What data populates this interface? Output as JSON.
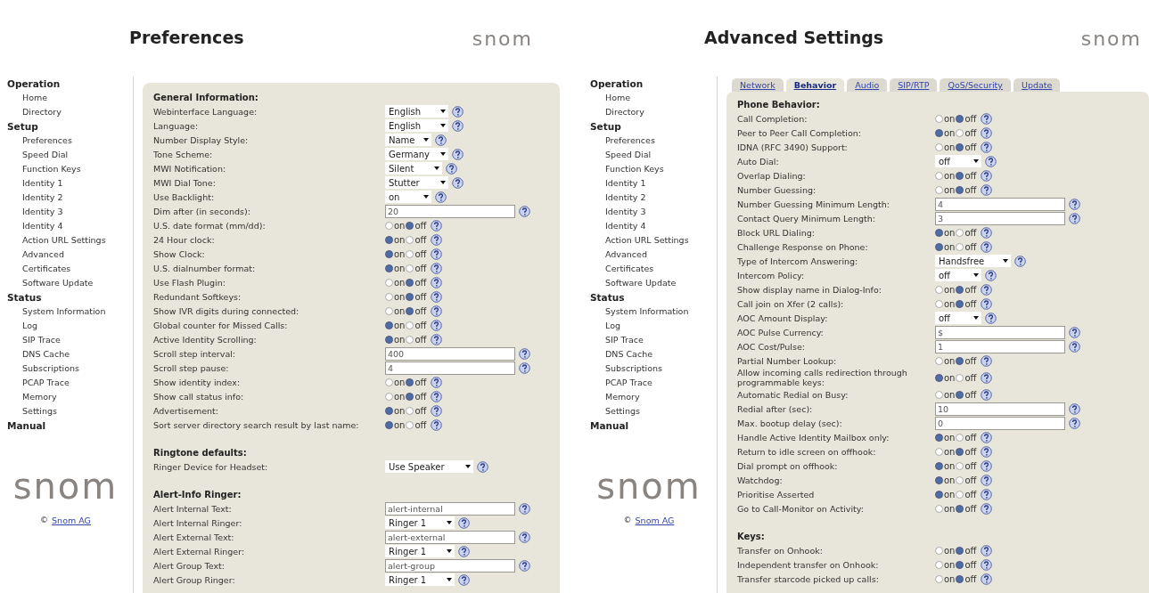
{
  "panels": [
    {
      "title": "Preferences",
      "header_logo": "snom",
      "sidebar": {
        "sections": [
          {
            "heading": "Operation",
            "items": [
              "Home",
              "Directory"
            ]
          },
          {
            "heading": "Setup",
            "items": [
              "Preferences",
              "Speed Dial",
              "Function Keys",
              "Identity 1",
              "Identity 2",
              "Identity 3",
              "Identity 4",
              "Action URL Settings",
              "Advanced",
              "Certificates",
              "Software Update"
            ]
          },
          {
            "heading": "Status",
            "items": [
              "System Information",
              "Log",
              "SIP Trace",
              "DNS Cache",
              "Subscriptions",
              "PCAP Trace",
              "Memory",
              "Settings"
            ]
          },
          {
            "heading": "Manual"
          }
        ],
        "logo": "snom",
        "copyright": {
          "symbol": "©",
          "link": "Snom AG"
        }
      },
      "form": {
        "sections": [
          {
            "heading": "General Information:",
            "rows": [
              {
                "kind": "select",
                "label": "Webinterface Language:",
                "value": "English"
              },
              {
                "kind": "select",
                "label": "Language:",
                "value": "English"
              },
              {
                "kind": "select",
                "label": "Number Display Style:",
                "value": "Name"
              },
              {
                "kind": "select",
                "label": "Tone Scheme:",
                "value": "Germany"
              },
              {
                "kind": "select",
                "label": "MWI Notification:",
                "value": "Silent"
              },
              {
                "kind": "select",
                "label": "MWI Dial Tone:",
                "value": "Stutter"
              },
              {
                "kind": "select",
                "label": "Use Backlight:",
                "value": "on"
              },
              {
                "kind": "text",
                "label": "Dim after (in seconds):",
                "value": "20"
              },
              {
                "kind": "radio",
                "label": "U.S. date format (mm/dd):",
                "options": [
                  {
                    "label": "on",
                    "selected": false
                  },
                  {
                    "label": "off",
                    "selected": true
                  }
                ]
              },
              {
                "kind": "radio",
                "label": "24 Hour clock:",
                "options": [
                  {
                    "label": "on",
                    "selected": true
                  },
                  {
                    "label": "off",
                    "selected": false
                  }
                ]
              },
              {
                "kind": "radio",
                "label": "Show Clock:",
                "options": [
                  {
                    "label": "on",
                    "selected": true
                  },
                  {
                    "label": "off",
                    "selected": false
                  }
                ]
              },
              {
                "kind": "radio",
                "label": "U.S. dialnumber format:",
                "options": [
                  {
                    "label": "on",
                    "selected": true
                  },
                  {
                    "label": "off",
                    "selected": false
                  }
                ]
              },
              {
                "kind": "radio",
                "label": "Use Flash Plugin:",
                "options": [
                  {
                    "label": "on",
                    "selected": false
                  },
                  {
                    "label": "off",
                    "selected": true
                  }
                ]
              },
              {
                "kind": "radio",
                "label": "Redundant Softkeys:",
                "options": [
                  {
                    "label": "on",
                    "selected": false
                  },
                  {
                    "label": "off",
                    "selected": true
                  }
                ]
              },
              {
                "kind": "radio",
                "label": "Show IVR digits during connected:",
                "options": [
                  {
                    "label": "on",
                    "selected": false
                  },
                  {
                    "label": "off",
                    "selected": true
                  }
                ]
              },
              {
                "kind": "radio",
                "label": "Global counter for Missed Calls:",
                "options": [
                  {
                    "label": "on",
                    "selected": true
                  },
                  {
                    "label": "off",
                    "selected": false
                  }
                ]
              },
              {
                "kind": "radio",
                "label": "Active Identity Scrolling:",
                "options": [
                  {
                    "label": "on",
                    "selected": true
                  },
                  {
                    "label": "off",
                    "selected": false
                  }
                ]
              },
              {
                "kind": "text",
                "label": "Scroll step interval:",
                "value": "400"
              },
              {
                "kind": "text",
                "label": "Scroll step pause:",
                "value": "4"
              },
              {
                "kind": "radio",
                "label": "Show identity index:",
                "options": [
                  {
                    "label": "on",
                    "selected": false
                  },
                  {
                    "label": "off",
                    "selected": true
                  }
                ]
              },
              {
                "kind": "radio",
                "label": "Show call status info:",
                "options": [
                  {
                    "label": "on",
                    "selected": false
                  },
                  {
                    "label": "off",
                    "selected": true
                  }
                ]
              },
              {
                "kind": "radio",
                "label": "Advertisement:",
                "options": [
                  {
                    "label": "on",
                    "selected": true
                  },
                  {
                    "label": "off",
                    "selected": false
                  }
                ]
              },
              {
                "kind": "radio",
                "label": "Sort server directory search result by last name:",
                "options": [
                  {
                    "label": "on",
                    "selected": true
                  },
                  {
                    "label": "off",
                    "selected": false
                  }
                ]
              }
            ]
          },
          {
            "heading": "Ringtone defaults:",
            "rows": [
              {
                "kind": "select",
                "label": "Ringer Device for Headset:",
                "value": "Use Speaker"
              }
            ]
          },
          {
            "heading": "Alert-Info Ringer:",
            "rows": [
              {
                "kind": "text",
                "label": "Alert Internal Text:",
                "value": "alert-internal"
              },
              {
                "kind": "select",
                "label": "Alert Internal Ringer:",
                "value": "Ringer 1"
              },
              {
                "kind": "text",
                "label": "Alert External Text:",
                "value": "alert-external"
              },
              {
                "kind": "select",
                "label": "Alert External Ringer:",
                "value": "Ringer 1"
              },
              {
                "kind": "text",
                "label": "Alert Group Text:",
                "value": "alert-group"
              },
              {
                "kind": "select",
                "label": "Alert Group Ringer:",
                "value": "Ringer 1"
              }
            ]
          }
        ]
      }
    },
    {
      "title": "Advanced Settings",
      "header_logo": "snom",
      "sidebar": {
        "sections": [
          {
            "heading": "Operation",
            "items": [
              "Home",
              "Directory"
            ]
          },
          {
            "heading": "Setup",
            "items": [
              "Preferences",
              "Speed Dial",
              "Function Keys",
              "Identity 1",
              "Identity 2",
              "Identity 3",
              "Identity 4",
              "Action URL Settings",
              "Advanced",
              "Certificates",
              "Software Update"
            ]
          },
          {
            "heading": "Status",
            "items": [
              "System Information",
              "Log",
              "SIP Trace",
              "DNS Cache",
              "Subscriptions",
              "PCAP Trace",
              "Memory",
              "Settings"
            ]
          },
          {
            "heading": "Manual"
          }
        ],
        "logo": "snom",
        "copyright": {
          "symbol": "©",
          "link": "Snom AG"
        }
      },
      "tabs": [
        {
          "label": "Network",
          "selected": false
        },
        {
          "label": "Behavior",
          "selected": true
        },
        {
          "label": "Audio",
          "selected": false
        },
        {
          "label": "SIP/RTP",
          "selected": false
        },
        {
          "label": "QoS/Security",
          "selected": false
        },
        {
          "label": "Update",
          "selected": false
        }
      ],
      "form": {
        "sections": [
          {
            "heading": "Phone Behavior:",
            "rows": [
              {
                "kind": "radio",
                "label": "Call Completion:",
                "options": [
                  {
                    "label": "on",
                    "selected": false
                  },
                  {
                    "label": "off",
                    "selected": true
                  }
                ]
              },
              {
                "kind": "radio",
                "label": "Peer to Peer Call Completion:",
                "options": [
                  {
                    "label": "on",
                    "selected": true
                  },
                  {
                    "label": "off",
                    "selected": false
                  }
                ]
              },
              {
                "kind": "radio",
                "label": "IDNA (RFC 3490) Support:",
                "options": [
                  {
                    "label": "on",
                    "selected": false
                  },
                  {
                    "label": "off",
                    "selected": true
                  }
                ]
              },
              {
                "kind": "select",
                "label": "Auto Dial:",
                "value": "off"
              },
              {
                "kind": "radio",
                "label": "Overlap Dialing:",
                "options": [
                  {
                    "label": "on",
                    "selected": false
                  },
                  {
                    "label": "off",
                    "selected": true
                  }
                ]
              },
              {
                "kind": "radio",
                "label": "Number Guessing:",
                "options": [
                  {
                    "label": "on",
                    "selected": false
                  },
                  {
                    "label": "off",
                    "selected": true
                  }
                ]
              },
              {
                "kind": "text",
                "label": "Number Guessing Minimum Length:",
                "value": "4"
              },
              {
                "kind": "text",
                "label": "Contact Query Minimum Length:",
                "value": "3"
              },
              {
                "kind": "radio",
                "label": "Block URL Dialing:",
                "options": [
                  {
                    "label": "on",
                    "selected": true
                  },
                  {
                    "label": "off",
                    "selected": false
                  }
                ]
              },
              {
                "kind": "radio",
                "label": "Challenge Response on Phone:",
                "options": [
                  {
                    "label": "on",
                    "selected": true
                  },
                  {
                    "label": "off",
                    "selected": false
                  }
                ]
              },
              {
                "kind": "select",
                "label": "Type of Intercom Answering:",
                "value": "Handsfree"
              },
              {
                "kind": "select",
                "label": "Intercom Policy:",
                "value": "off"
              },
              {
                "kind": "radio",
                "label": "Show display name in Dialog-Info:",
                "options": [
                  {
                    "label": "on",
                    "selected": false
                  },
                  {
                    "label": "off",
                    "selected": true
                  }
                ]
              },
              {
                "kind": "radio",
                "label": "Call join on Xfer (2 calls):",
                "options": [
                  {
                    "label": "on",
                    "selected": false
                  },
                  {
                    "label": "off",
                    "selected": true
                  }
                ]
              },
              {
                "kind": "select",
                "label": "AOC Amount Display:",
                "value": "off"
              },
              {
                "kind": "text",
                "label": "AOC Pulse Currency:",
                "value": "$"
              },
              {
                "kind": "text",
                "label": "AOC Cost/Pulse:",
                "value": "1"
              },
              {
                "kind": "radio",
                "label": "Partial Number Lookup:",
                "options": [
                  {
                    "label": "on",
                    "selected": false
                  },
                  {
                    "label": "off",
                    "selected": true
                  }
                ]
              },
              {
                "kind": "radio",
                "label": "Allow incoming calls redirection through programmable keys:",
                "options": [
                  {
                    "label": "on",
                    "selected": true
                  },
                  {
                    "label": "off",
                    "selected": false
                  }
                ]
              },
              {
                "kind": "radio",
                "label": "Automatic Redial on Busy:",
                "options": [
                  {
                    "label": "on",
                    "selected": false
                  },
                  {
                    "label": "off",
                    "selected": true
                  }
                ]
              },
              {
                "kind": "text",
                "label": "Redial after (sec):",
                "value": "10"
              },
              {
                "kind": "text",
                "label": "Max. bootup delay (sec):",
                "value": "0"
              },
              {
                "kind": "radio",
                "label": "Handle Active Identity Mailbox only:",
                "options": [
                  {
                    "label": "on",
                    "selected": true
                  },
                  {
                    "label": "off",
                    "selected": false
                  }
                ]
              },
              {
                "kind": "radio",
                "label": "Return to idle screen on offhook:",
                "options": [
                  {
                    "label": "on",
                    "selected": false
                  },
                  {
                    "label": "off",
                    "selected": true
                  }
                ]
              },
              {
                "kind": "radio",
                "label": "Dial prompt on offhook:",
                "options": [
                  {
                    "label": "on",
                    "selected": true
                  },
                  {
                    "label": "off",
                    "selected": false
                  }
                ]
              },
              {
                "kind": "radio",
                "label": "Watchdog:",
                "options": [
                  {
                    "label": "on",
                    "selected": true
                  },
                  {
                    "label": "off",
                    "selected": false
                  }
                ]
              },
              {
                "kind": "radio",
                "label": "Prioritise Asserted",
                "options": [
                  {
                    "label": "on",
                    "selected": true
                  },
                  {
                    "label": "off",
                    "selected": false
                  }
                ]
              },
              {
                "kind": "radio",
                "label": "Go to Call-Monitor on Activity:",
                "options": [
                  {
                    "label": "on",
                    "selected": false
                  },
                  {
                    "label": "off",
                    "selected": true
                  }
                ]
              }
            ]
          },
          {
            "heading": "Keys:",
            "rows": [
              {
                "kind": "radio",
                "label": "Transfer on Onhook:",
                "options": [
                  {
                    "label": "on",
                    "selected": false
                  },
                  {
                    "label": "off",
                    "selected": true
                  }
                ]
              },
              {
                "kind": "radio",
                "label": "Independent transfer on Onhook:",
                "options": [
                  {
                    "label": "on",
                    "selected": false
                  },
                  {
                    "label": "off",
                    "selected": true
                  }
                ]
              },
              {
                "kind": "radio",
                "label": "Transfer starcode picked up calls:",
                "options": [
                  {
                    "label": "on",
                    "selected": false
                  },
                  {
                    "label": "off",
                    "selected": true
                  }
                ]
              }
            ]
          }
        ]
      }
    }
  ]
}
